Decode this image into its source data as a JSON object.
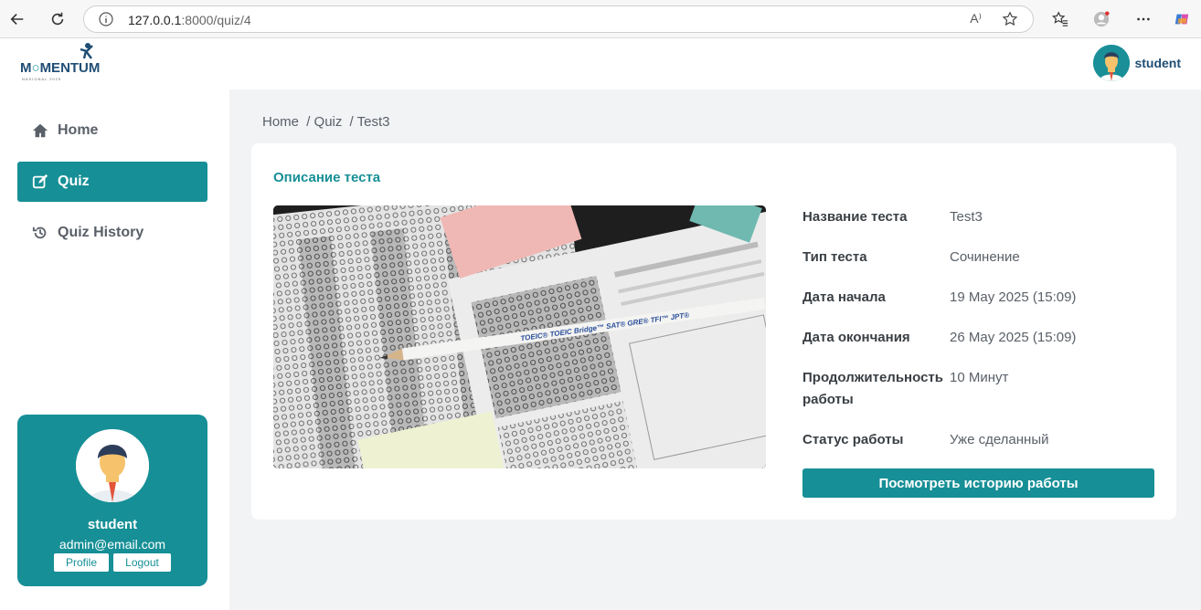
{
  "browser": {
    "url_host": "127.0.0.1",
    "url_path": ":8000/quiz/4",
    "reader_label": "A⁾"
  },
  "header": {
    "logo_word_1": "M",
    "logo_word_2": "MENTUM",
    "logo_sub": "NASIONAL 2025",
    "username": "student"
  },
  "sidebar": {
    "items": [
      {
        "label": "Home"
      },
      {
        "label": "Quiz"
      },
      {
        "label": "Quiz History"
      }
    ],
    "user_card": {
      "name": "student",
      "email": "admin@email.com",
      "profile_label": "Profile",
      "logout_label": "Logout"
    }
  },
  "breadcrumb": [
    "Home",
    "/ Quiz",
    "/ Test3"
  ],
  "panel": {
    "title": "Описание теста",
    "rows": [
      {
        "label": "Название теста",
        "value": "Test3"
      },
      {
        "label": "Тип теста",
        "value": "Сочинение"
      },
      {
        "label": "Дата начала",
        "value": "19 May 2025 (15:09)"
      },
      {
        "label": "Дата окончания",
        "value": "26 May 2025 (15:09)"
      },
      {
        "label": "Продолжительность работы",
        "value": "10 Минут"
      },
      {
        "label": "Статус работы",
        "value": "Уже сделанный"
      }
    ],
    "history_button": "Посмотреть историю работы",
    "pencil_text": "TOEIC®  TOEIC Bridge™  SAT®  GRE®  TFI™  JPT®"
  },
  "colors": {
    "accent": "#168f96",
    "brand_dark": "#1f4d74"
  }
}
